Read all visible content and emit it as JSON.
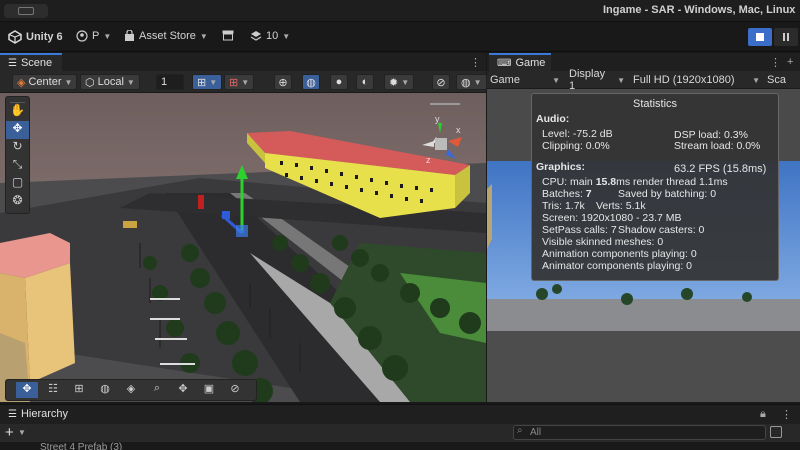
{
  "window": {
    "title": "Ingame - SAR - Windows, Mac, Linux"
  },
  "toolbar": {
    "account_label": "Unity 6",
    "profile_label": "P",
    "asset_store_label": "Asset Store",
    "layers_count": "10"
  },
  "scene": {
    "tab_label": "Scene",
    "pivot_label": "Center",
    "space_label": "Local",
    "grid_value": "1"
  },
  "game": {
    "tab_label": "Game",
    "mode_label": "Game",
    "display_label": "Display 1",
    "resolution_label": "Full HD (1920x1080)",
    "scale_label": "Sca"
  },
  "statistics": {
    "title": "Statistics",
    "audio_heading": "Audio:",
    "level": "Level: -75.2 dB",
    "clipping": "Clipping: 0.0%",
    "dsp_load": "DSP load: 0.3%",
    "stream_load": "Stream load: 0.0%",
    "graphics_heading": "Graphics:",
    "fps": "63.2 FPS (15.8ms)",
    "cpu_prefix": "CPU: main ",
    "cpu_main": "15.8",
    "cpu_suffix": "ms  render thread 1.1ms",
    "batches_prefix": "Batches: ",
    "batches": "7",
    "saved_batching": "Saved by batching: 0",
    "tris": "Tris: 1.7k",
    "verts": "Verts: 5.1k",
    "screen": "Screen: 1920x1080 - 23.7 MB",
    "setpass": "SetPass calls: 7",
    "shadow_casters": "Shadow casters: 0",
    "skinned": "Visible skinned meshes: 0",
    "animation": "Animation components playing: 0",
    "animator": "Animator components playing: 0"
  },
  "hierarchy": {
    "tab_label": "Hierarchy",
    "add_label": "+",
    "search_placeholder": "All",
    "partial_row": "Street 4 Prefab (3)"
  },
  "colors": {
    "accent": "#3a79d7",
    "building_yellow": "#e8e04a",
    "roof_red": "#d0505a",
    "gizmo_green": "#2ed02e"
  }
}
